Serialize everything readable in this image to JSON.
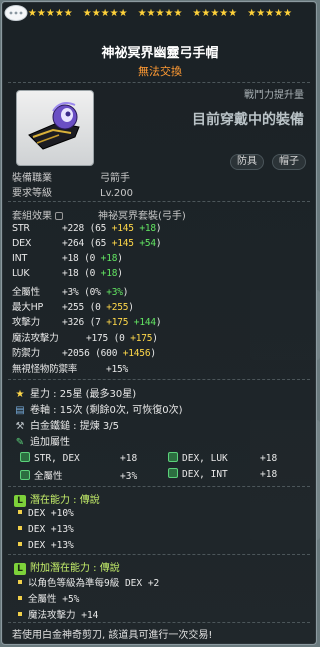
{
  "header": {
    "star_groups": [
      "★★★★★",
      "★★★★★",
      "★★★★★",
      "★★★★★",
      "★★★★★"
    ],
    "star_force_current": 25,
    "star_force_max": 30
  },
  "item": {
    "name": "神祕冥界幽靈弓手帽",
    "trade_status": "無法交換",
    "power_label": "戰鬥力提升量",
    "power_status": "目前穿戴中的裝備",
    "tags": [
      "防具",
      "帽子"
    ]
  },
  "requirements": [
    {
      "label": "裝備職業",
      "value": "弓箭手"
    },
    {
      "label": "要求等級",
      "value": "Lv.200"
    }
  ],
  "set": {
    "label": "套組效果",
    "name": "神祕冥界套裝(弓手)"
  },
  "stats": [
    {
      "name": "STR",
      "total": "+228",
      "base": "65",
      "bonus": "+145",
      "star": "+18"
    },
    {
      "name": "DEX",
      "total": "+264",
      "base": "65",
      "bonus": "+145",
      "star": "+54"
    },
    {
      "name": "INT",
      "total": "+18",
      "base": "0",
      "bonus": "",
      "star": "+18"
    },
    {
      "name": "LUK",
      "total": "+18",
      "base": "0",
      "bonus": "",
      "star": "+18"
    },
    {
      "name": "全屬性",
      "total": "+3%",
      "base": "0%",
      "bonus": "",
      "star": "+3%"
    },
    {
      "name": "最大HP",
      "total": "+255",
      "base": "0",
      "bonus": "+255",
      "star": ""
    },
    {
      "name": "攻擊力",
      "total": "+326",
      "base": "7",
      "bonus": "+175",
      "star": "+144"
    },
    {
      "name": "魔法攻擊力",
      "total": "+175",
      "base": "0",
      "bonus": "+175",
      "star": ""
    },
    {
      "name": "防禦力",
      "total": "+2056",
      "base": "600",
      "bonus": "+1456",
      "star": ""
    },
    {
      "name": "無視怪物防禦率",
      "total": "+15%",
      "base": "",
      "bonus": "",
      "star": ""
    }
  ],
  "extra": {
    "star_force": "星力 : 25星 (最多30星)",
    "scroll": "卷軸 : 15次 (剩餘0次, 可恢復0次)",
    "hammer": "白金鐵鎚 : 提煉 3/5",
    "flame_title": "追加屬性",
    "flames": [
      [
        "STR, DEX",
        "+18"
      ],
      [
        "DEX, LUK",
        "+18"
      ],
      [
        "全屬性",
        "+3%"
      ],
      [
        "DEX, INT",
        "+18"
      ]
    ]
  },
  "potential": {
    "title": "潛在能力 : 傳說",
    "badge": "L",
    "lines": [
      "DEX +10%",
      "DEX +13%",
      "DEX +13%"
    ]
  },
  "bonus_potential": {
    "title": "附加潛在能力 : 傳說",
    "badge": "L",
    "lines": [
      "以角色等級為準每9級 DEX +2",
      "全屬性 +5%",
      "魔法攻擊力 +14"
    ]
  },
  "footer": "若使用白金神奇剪刀, 該道具可進行一次交易!",
  "colors": {
    "star": "#ffd23a",
    "bonus": "#ffd84a",
    "star_bonus": "#62e462",
    "untradeable": "#ff9a33"
  }
}
